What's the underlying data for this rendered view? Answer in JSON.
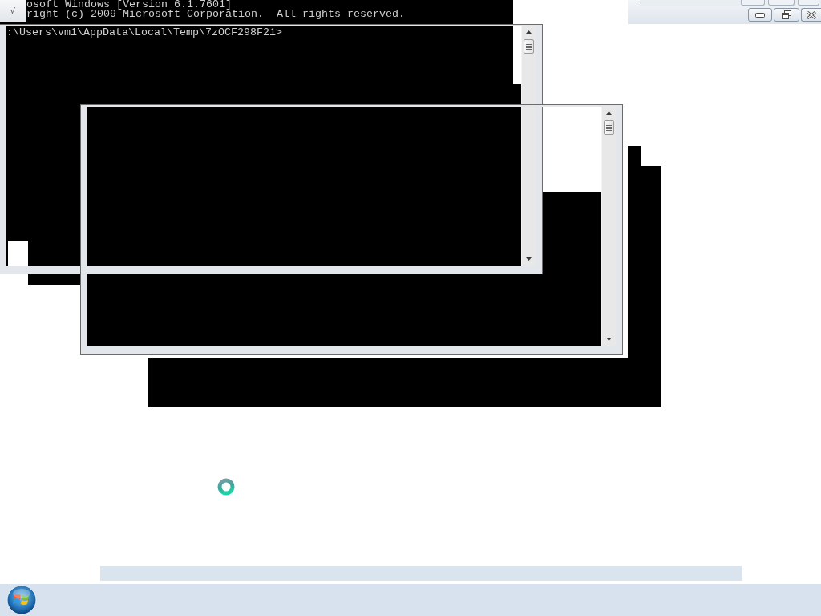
{
  "window_menu": {
    "label": "√"
  },
  "console_text": {
    "lines": [
      "osoft Windows [Version 6.1.7601]",
      "right (c) 2009 Microsoft Corporation.  All rights reserved."
    ]
  },
  "title_bar": {
    "caption_buttons": [
      {
        "kind": "minimize"
      },
      {
        "kind": "restore"
      },
      {
        "kind": "close"
      }
    ]
  },
  "command_window": {
    "prompt": ":\\Users\\vm1\\AppData\\Local\\Temp\\7zOCF298F21>"
  }
}
